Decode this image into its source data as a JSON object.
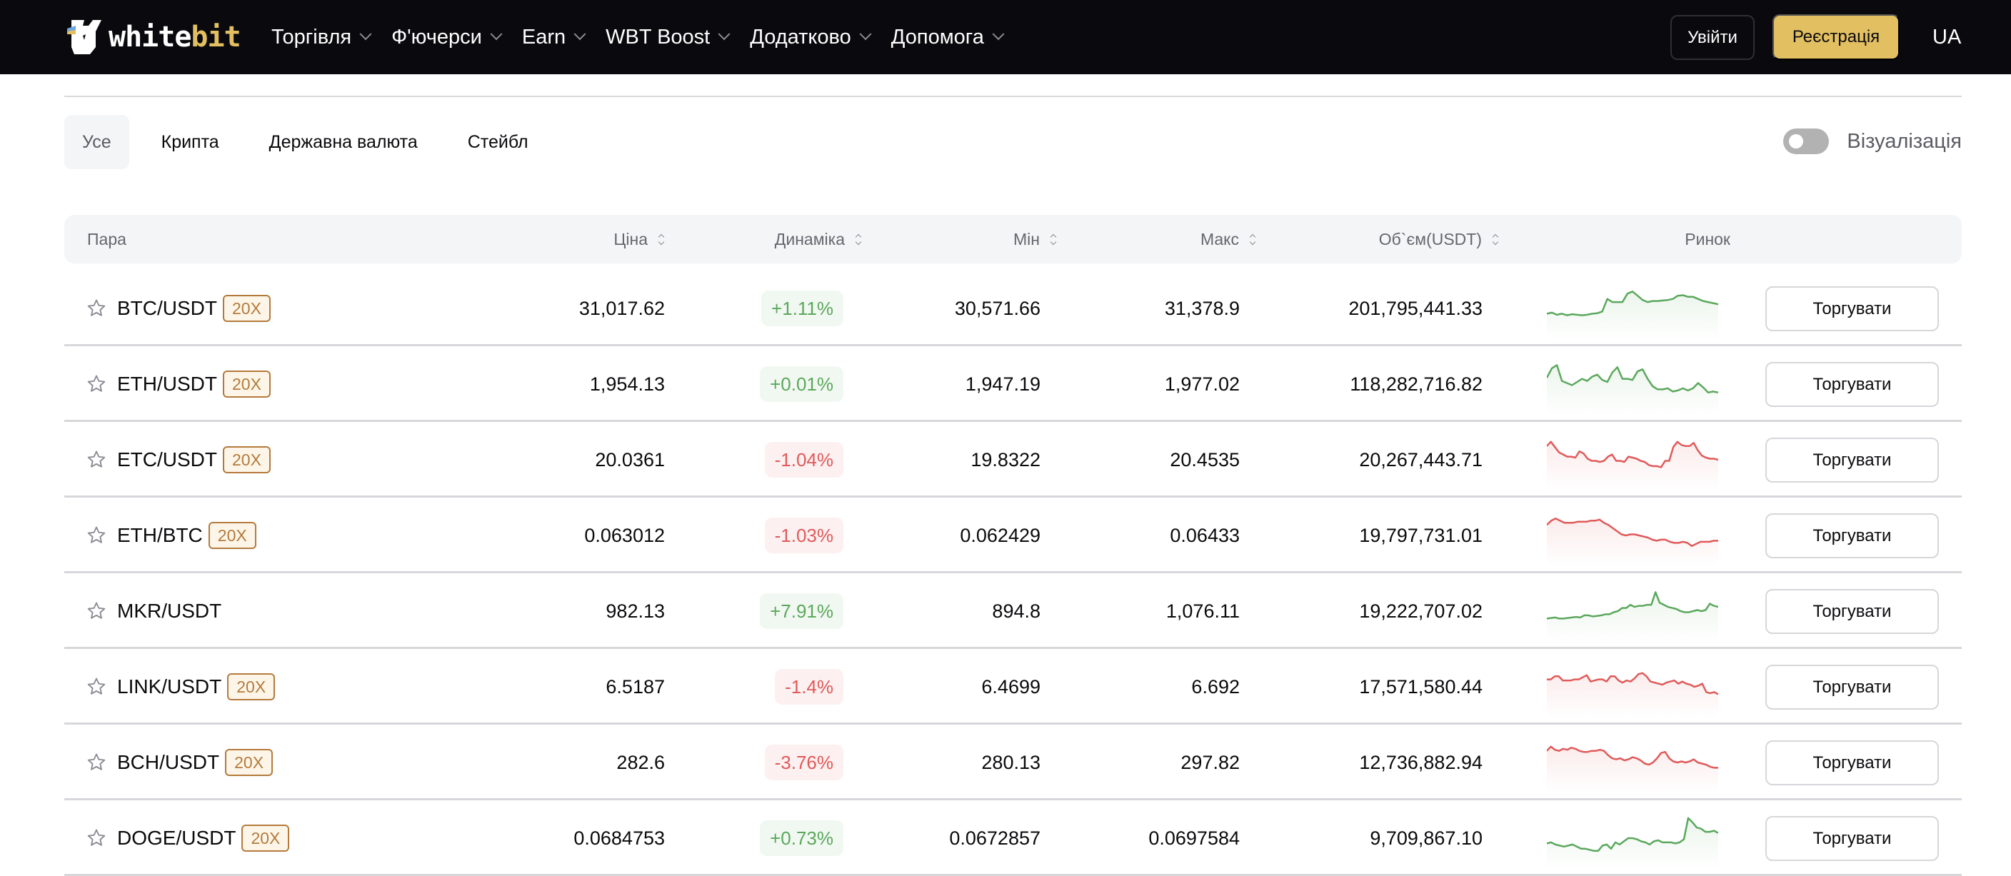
{
  "header": {
    "logo": {
      "text_white": "white",
      "text_gold": "bit",
      "brand_color": "#e2bf60"
    },
    "nav": [
      {
        "label": "Торгівля",
        "icon": "chevron-down-icon"
      },
      {
        "label": "Ф'ючерси",
        "icon": "chevron-down-icon"
      },
      {
        "label": "Earn",
        "icon": "chevron-down-icon"
      },
      {
        "label": "WBT Boost",
        "icon": "chevron-down-icon"
      },
      {
        "label": "Додатково",
        "icon": "chevron-down-icon"
      },
      {
        "label": "Допомога",
        "icon": "chevron-down-icon"
      }
    ],
    "login_label": "Увійти",
    "register_label": "Реєстрація",
    "language": "UA"
  },
  "filters": {
    "tabs": [
      {
        "label": "Усе",
        "active": true
      },
      {
        "label": "Крипта",
        "active": false
      },
      {
        "label": "Державна валюта",
        "active": false
      },
      {
        "label": "Стейбл",
        "active": false
      }
    ],
    "visualization_label": "Візуалізація",
    "visualization_on": false
  },
  "table": {
    "columns": {
      "pair": "Пара",
      "price": "Ціна",
      "change": "Динаміка",
      "low": "Мін",
      "high": "Макс",
      "volume": "Об`єм(USDT)",
      "market": "Ринок"
    },
    "trade_label": "Торгувати",
    "colors": {
      "up": "#5ba85d",
      "down": "#e05a5a"
    },
    "rows": [
      {
        "base": "BTC",
        "quote": "/USDT",
        "leverage": "20X",
        "price": "31,017.62",
        "change": "+1.11%",
        "dir": "up",
        "low": "30,571.66",
        "high": "31,378.9",
        "volume": "201,795,441.33",
        "spark": [
          40,
          42,
          38,
          40,
          37,
          39,
          38,
          37,
          38,
          40,
          41,
          44,
          68,
          62,
          62,
          62,
          78,
          82,
          74,
          66,
          62,
          64,
          64,
          65,
          66,
          68,
          74,
          75,
          72,
          72,
          68,
          64,
          62,
          60,
          58
        ]
      },
      {
        "base": "ETH",
        "quote": "/USDT",
        "leverage": "20X",
        "price": "1,954.13",
        "change": "+0.01%",
        "dir": "up",
        "low": "1,947.19",
        "high": "1,977.02",
        "volume": "118,282,716.82",
        "spark": [
          62,
          80,
          86,
          56,
          52,
          48,
          54,
          60,
          56,
          64,
          68,
          58,
          54,
          72,
          82,
          60,
          60,
          58,
          74,
          78,
          60,
          46,
          40,
          40,
          42,
          36,
          38,
          42,
          38,
          42,
          52,
          44,
          34,
          36,
          34
        ]
      },
      {
        "base": "ETC",
        "quote": "/USDT",
        "leverage": "20X",
        "price": "20.0361",
        "change": "-1.04%",
        "dir": "down",
        "low": "19.8322",
        "high": "20.4535",
        "volume": "20,267,443.71",
        "spark": [
          76,
          84,
          74,
          64,
          60,
          56,
          56,
          54,
          66,
          62,
          52,
          48,
          48,
          46,
          48,
          56,
          60,
          48,
          48,
          46,
          56,
          54,
          52,
          48,
          46,
          40,
          38,
          38,
          36,
          48,
          48,
          74,
          84,
          78,
          76,
          76,
          82,
          68,
          58,
          54,
          52,
          52,
          50
        ]
      },
      {
        "base": "ETH",
        "quote": "/BTC",
        "leverage": "20X",
        "price": "0.063012",
        "change": "-1.03%",
        "dir": "down",
        "low": "0.062429",
        "high": "0.06433",
        "volume": "19,797,731.01",
        "spark": [
          70,
          78,
          82,
          78,
          74,
          74,
          74,
          76,
          76,
          76,
          78,
          78,
          80,
          74,
          70,
          64,
          58,
          52,
          50,
          52,
          52,
          50,
          48,
          46,
          42,
          40,
          42,
          42,
          38,
          36,
          36,
          38,
          36,
          30,
          34,
          38,
          38,
          38,
          40,
          40
        ]
      },
      {
        "base": "MKR",
        "quote": "/USDT",
        "leverage": "",
        "price": "982.13",
        "change": "+7.91%",
        "dir": "up",
        "low": "894.8",
        "high": "1,076.11",
        "volume": "19,222,707.02",
        "spark": [
          36,
          37,
          38,
          36,
          36,
          37,
          38,
          39,
          38,
          42,
          42,
          40,
          41,
          42,
          44,
          44,
          48,
          50,
          56,
          56,
          62,
          58,
          60,
          60,
          62,
          62,
          86,
          66,
          62,
          58,
          56,
          54,
          50,
          48,
          48,
          50,
          52,
          50,
          52,
          64,
          60,
          58
        ]
      },
      {
        "base": "LINK",
        "quote": "/USDT",
        "leverage": "20X",
        "price": "6.5187",
        "change": "-1.4%",
        "dir": "down",
        "low": "6.4699",
        "high": "6.692",
        "volume": "17,571,580.44",
        "spark": [
          64,
          64,
          70,
          70,
          62,
          62,
          62,
          64,
          64,
          68,
          72,
          60,
          62,
          64,
          64,
          60,
          70,
          70,
          62,
          58,
          62,
          60,
          66,
          74,
          76,
          70,
          60,
          58,
          56,
          54,
          58,
          60,
          62,
          56,
          60,
          56,
          54,
          50,
          52,
          56,
          40,
          38,
          40,
          36
        ]
      },
      {
        "base": "BCH",
        "quote": "/USDT",
        "leverage": "20X",
        "price": "282.6",
        "change": "-3.76%",
        "dir": "down",
        "low": "280.13",
        "high": "297.82",
        "volume": "12,736,882.94",
        "spark": [
          72,
          80,
          74,
          72,
          76,
          74,
          78,
          76,
          72,
          70,
          70,
          72,
          72,
          74,
          72,
          64,
          58,
          56,
          58,
          54,
          56,
          60,
          58,
          54,
          48,
          46,
          50,
          58,
          68,
          70,
          58,
          52,
          50,
          52,
          50,
          52,
          56,
          50,
          48,
          46,
          42,
          40,
          40
        ]
      },
      {
        "base": "DOGE",
        "quote": "/USDT",
        "leverage": "20X",
        "price": "0.0684753",
        "change": "+0.73%",
        "dir": "up",
        "low": "0.0672857",
        "high": "0.0697584",
        "volume": "9,709,867.10",
        "spark": [
          40,
          42,
          38,
          36,
          34,
          36,
          38,
          34,
          30,
          30,
          28,
          26,
          26,
          36,
          38,
          30,
          42,
          38,
          44,
          50,
          50,
          48,
          44,
          42,
          38,
          44,
          46,
          42,
          42,
          42,
          40,
          42,
          48,
          88,
          80,
          70,
          68,
          62,
          62,
          64,
          60
        ]
      }
    ]
  }
}
